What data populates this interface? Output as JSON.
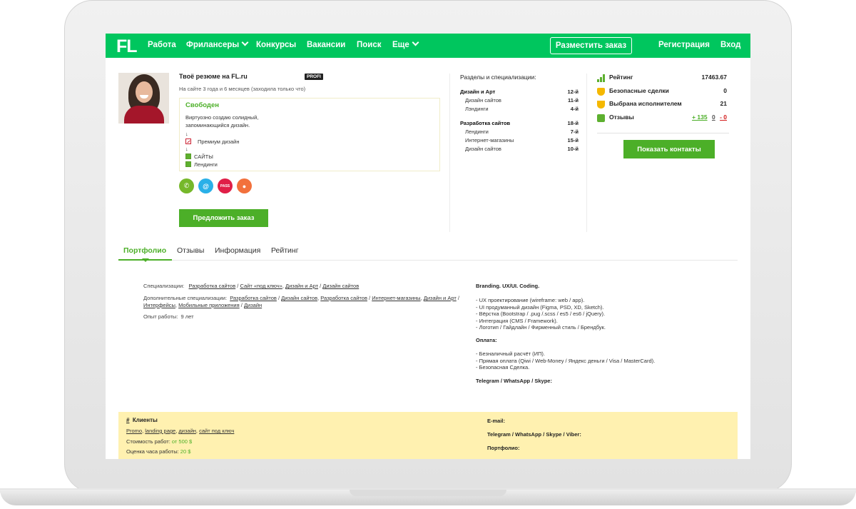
{
  "nav": {
    "logo": "FL",
    "items": [
      {
        "label": "Работа",
        "dropdown": false
      },
      {
        "label": "Фрилансеры",
        "dropdown": true
      },
      {
        "label": "Конкурсы",
        "dropdown": false
      },
      {
        "label": "Вакансии",
        "dropdown": false
      },
      {
        "label": "Поиск",
        "dropdown": false
      },
      {
        "label": "Еще",
        "dropdown": true
      }
    ],
    "post_order": "Разместить заказ",
    "register": "Регистрация",
    "login": "Вход"
  },
  "profile": {
    "resume_title": "Твоё резюме на FL.ru",
    "profi_badge": "PROFI",
    "site_age": "На сайте 3 года и 6 месяцев (заходила только что)",
    "status": "Свободен",
    "about_1": "Виртуозно создаю солидный,",
    "about_2": "запоминающийся дизайн.",
    "arrow": "↓",
    "check_1": "Премиум дизайн",
    "check_2": "САЙТЫ",
    "check_3": "Лендинги",
    "pass_icon": "PASS",
    "offer_button": "Предложить заказ"
  },
  "specs": {
    "title": "Разделы и специализации:",
    "items": [
      {
        "name": "Дизайн и Арт",
        "rank": "12-й",
        "group": true
      },
      {
        "name": "Дизайн сайтов",
        "rank": "11-й",
        "group": false
      },
      {
        "name": "Лэндинги",
        "rank": "4-й",
        "group": false
      },
      {
        "name": "Разработка сайтов",
        "rank": "18-й",
        "group": true
      },
      {
        "name": "Лендинги",
        "rank": "7-й",
        "group": false
      },
      {
        "name": "Интернет-магазины",
        "rank": "15-й",
        "group": false
      },
      {
        "name": "Дизайн сайтов",
        "rank": "10-й",
        "group": false
      }
    ]
  },
  "rating": {
    "rating_label": "Рейтинг",
    "rating_value": "17463.67",
    "safe_deals_label": "Безопасные сделки",
    "safe_deals_value": "0",
    "chosen_label": "Выбрана исполнителем",
    "chosen_value": "21",
    "reviews_label": "Отзывы",
    "reviews_pos": "+ 135",
    "reviews_zero": "0",
    "reviews_neg": "- 0",
    "show_contacts": "Показать контакты"
  },
  "tabs": [
    {
      "label": "Портфолио",
      "active": true
    },
    {
      "label": "Отзывы",
      "active": false
    },
    {
      "label": "Информация",
      "active": false
    },
    {
      "label": "Рейтинг",
      "active": false
    }
  ],
  "info": {
    "spec_label": "Специализации:",
    "spec_1": "Разработка сайтов",
    "spec_sep_1": " / ",
    "spec_2": "Сайт «под ключ»",
    "spec_sep_2": ", ",
    "spec_3": "Дизайн и Арт",
    "spec_sep_3": " / ",
    "spec_4": "Дизайн сайтов",
    "extra_label": "Дополнительные специализации:",
    "extra_1": "Разработка сайтов",
    "extra_2": "Дизайн сайтов",
    "extra_3": "Разработка сайтов",
    "extra_4": "Интернет-магазины",
    "extra_5": "Дизайн и Арт",
    "extra_6": "Интерфейсы",
    "extra_7": "Мобильные приложения",
    "extra_8": "Дизайн",
    "experience_label": "Опыт работы:",
    "experience_value": "9 лет"
  },
  "description": {
    "heading": "Branding. UX/UI. Coding.",
    "lines": [
      "- UX проектирование (wireframe: web / app).",
      "- UI продуманный дизайн (Figma, PSD, XD, Sketch).",
      "- Вёрстка (Bootstrap / .pug /.scss / es5 / es6 / jQuery).",
      "- Интеграция (CMS / Framework).",
      "- Логотип / Гайдлайн / Фирменный стиль / Брендбук."
    ],
    "payment_heading": "Оплата:",
    "payment_lines": [
      "- Безналичный расчёт (ИП).",
      "- Прямая оплата (Qiwi / Web-Money / Яндекс деньги / Visa / MasterCard).",
      "- Безопасная Сделка."
    ],
    "messengers": "Telegram / WhatsApp / Skype:"
  },
  "clients": {
    "hash": "#",
    "title": "Клиенты",
    "tag_1": "Promo",
    "tag_2": "landing page",
    "tag_3": "дизайн",
    "tag_4": "сайт под ключ",
    "cost_label": "Стоимость работ:",
    "cost_value": "от 500 $",
    "hour_label": "Оценка часа работы:",
    "hour_value": "20 $",
    "email_label": "E-mail:",
    "messengers_label": "Telegram / WhatsApp / Skype / Viber:",
    "portfolio_label": "Портфолио:"
  },
  "colors": {
    "brand_green": "#00c65e",
    "accent_green": "#4caf28",
    "negative_red": "#d31b1b",
    "clients_bg": "#fff1b0"
  }
}
